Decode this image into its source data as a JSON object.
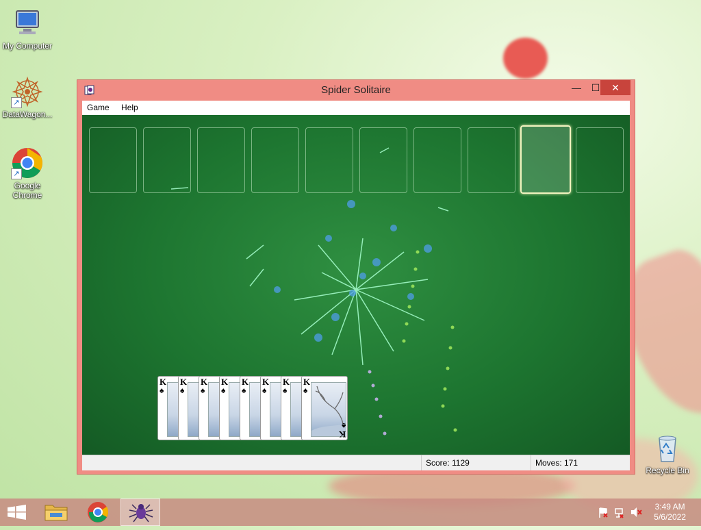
{
  "desktop": {
    "icons": [
      {
        "label": "My Computer"
      },
      {
        "label": "DataWagon..."
      },
      {
        "label": "Google Chrome"
      },
      {
        "label": "Recycle Bin"
      }
    ]
  },
  "window": {
    "title": "Spider Solitaire",
    "controls": {
      "minimize": "—",
      "maximize": "☐",
      "close": "✕"
    },
    "menu": [
      "Game",
      "Help"
    ]
  },
  "game": {
    "foundation_slot_count": 10,
    "selected_slot_index": 8,
    "cards": [
      {
        "rank": "K",
        "suit": "♠"
      },
      {
        "rank": "K",
        "suit": "♠"
      },
      {
        "rank": "K",
        "suit": "♠"
      },
      {
        "rank": "K",
        "suit": "♠"
      },
      {
        "rank": "K",
        "suit": "♠"
      },
      {
        "rank": "K",
        "suit": "♠"
      },
      {
        "rank": "K",
        "suit": "♠"
      },
      {
        "rank": "K",
        "suit": "♠"
      }
    ]
  },
  "status": {
    "score_label": "Score: 1129",
    "moves_label": "Moves:  171"
  },
  "taskbar": {
    "items": [
      "start-button",
      "file-explorer",
      "google-chrome",
      "spider-solitaire"
    ],
    "clock_time": "3:49 AM",
    "clock_date": "5/6/2022"
  },
  "colors": {
    "window_frame": "#f08c84",
    "felt": "#1d7530",
    "close_button": "#c8443c"
  }
}
